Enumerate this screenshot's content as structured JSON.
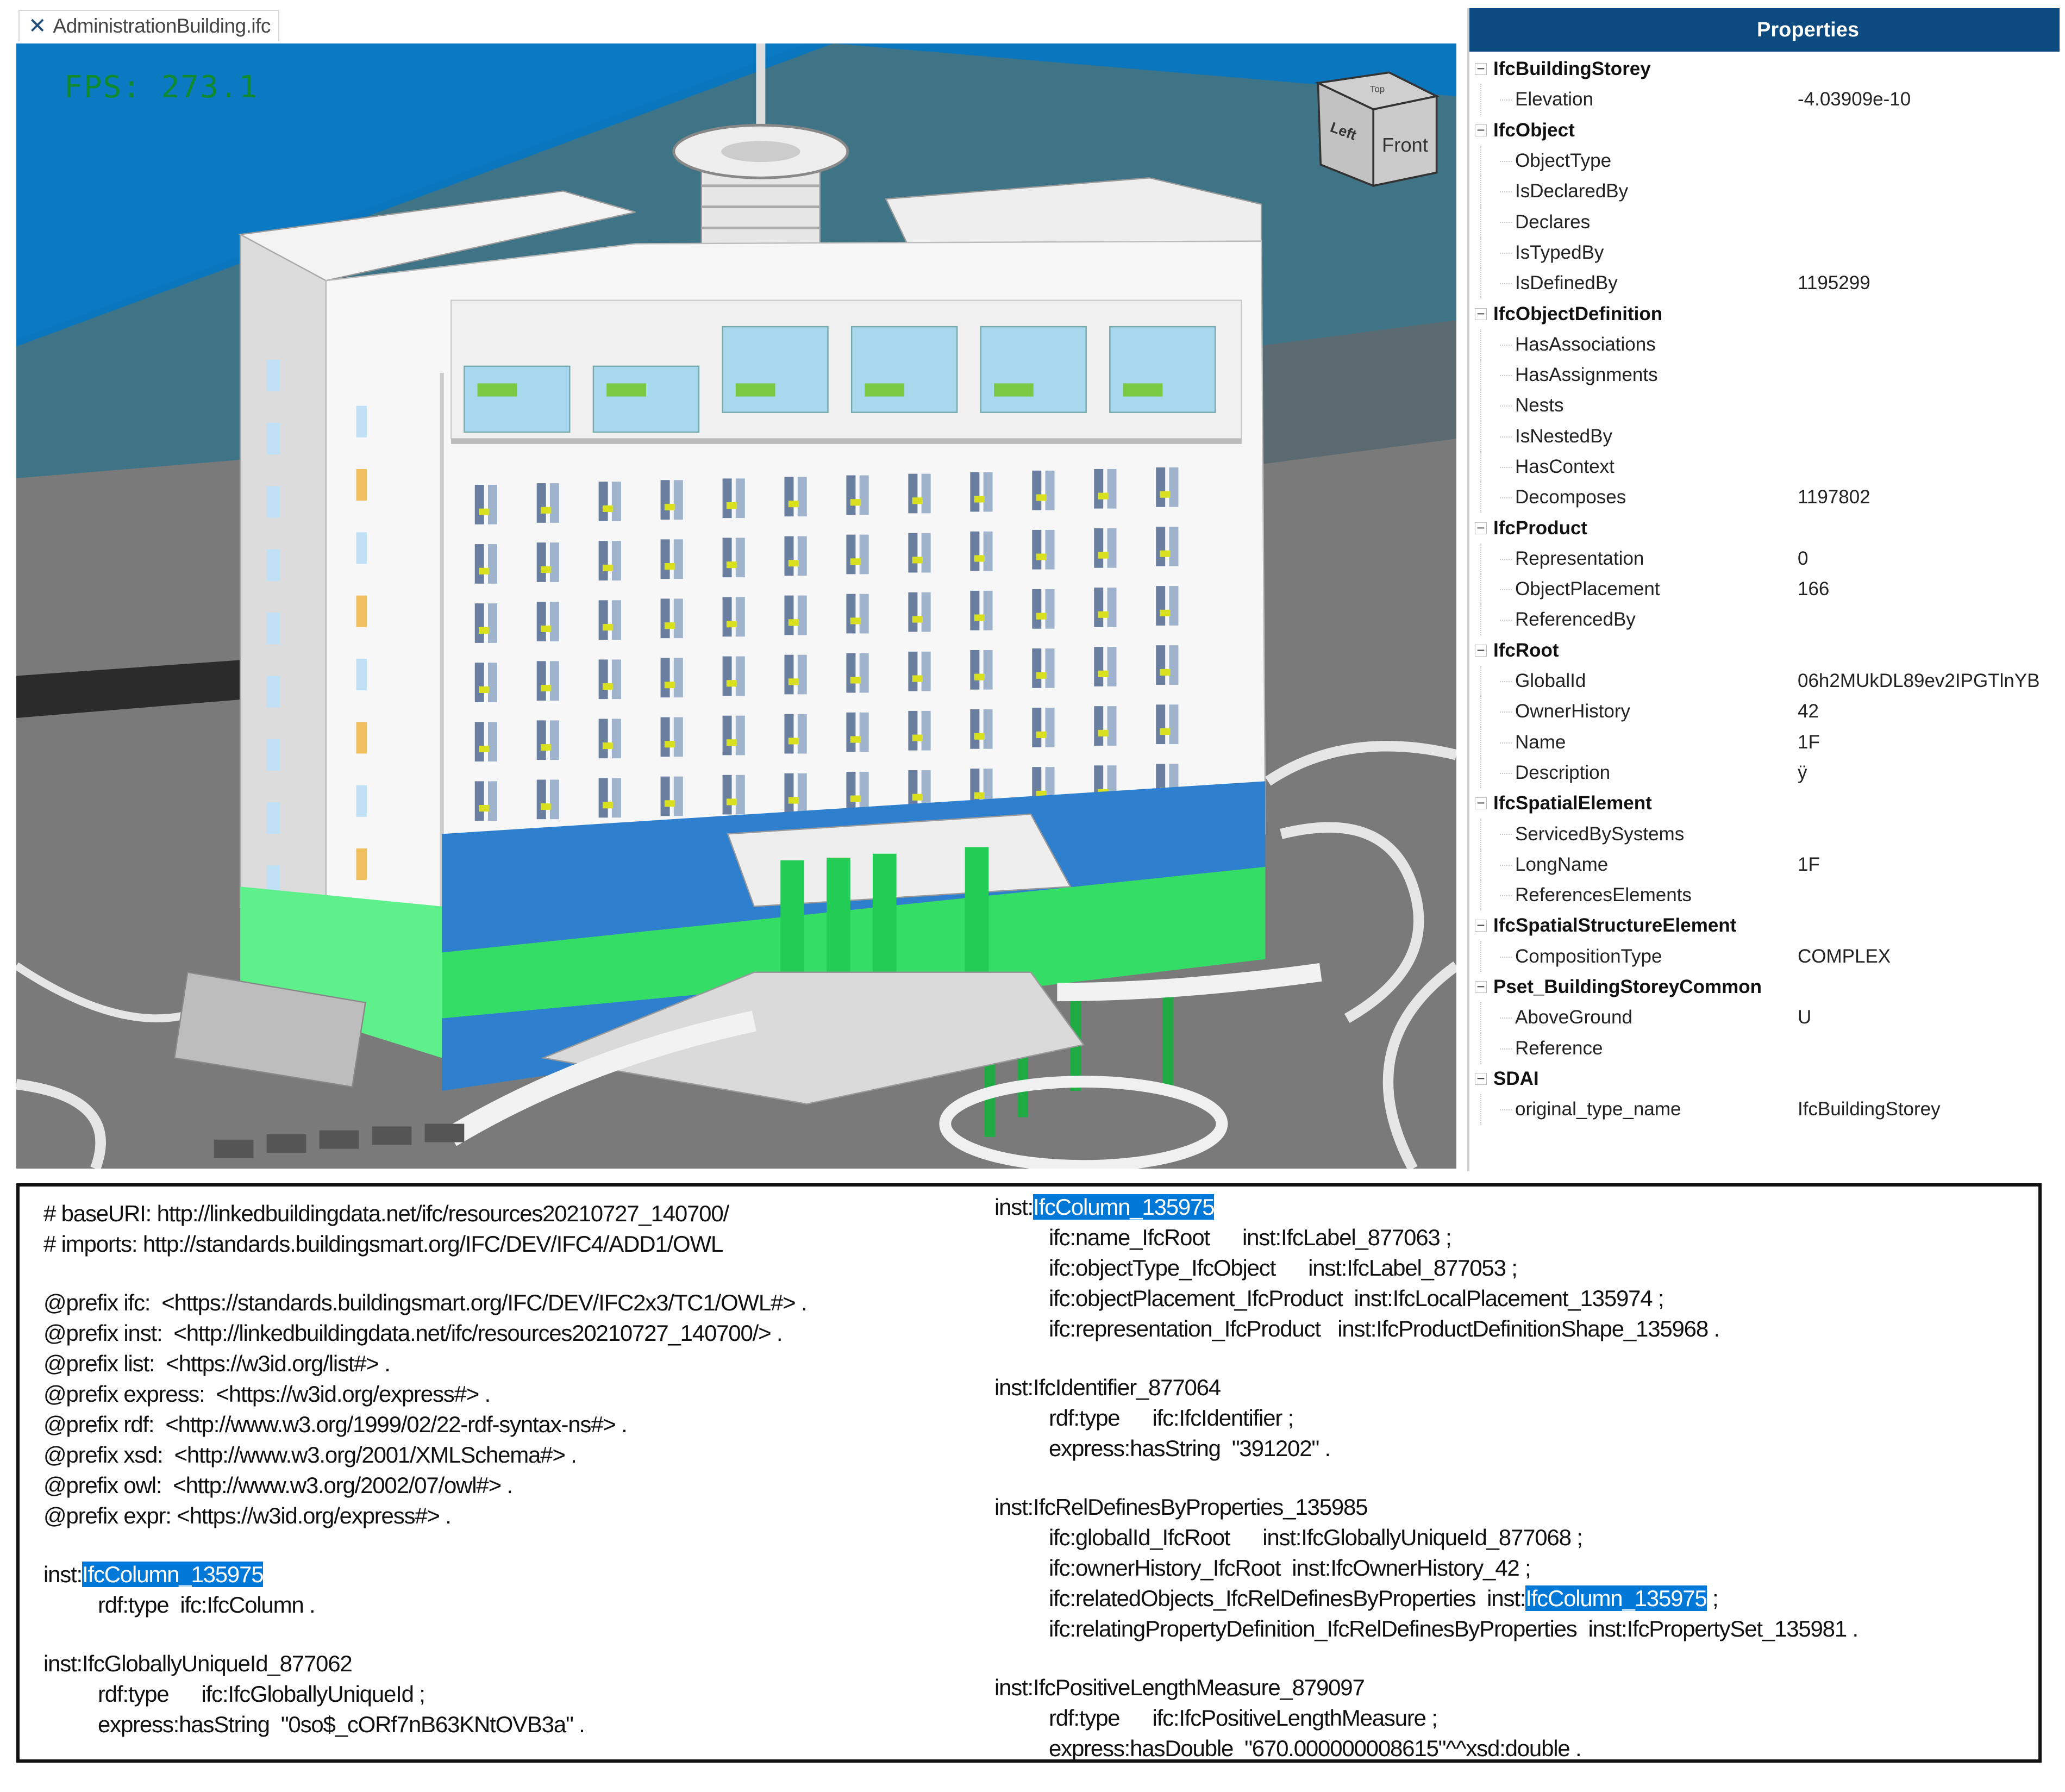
{
  "tab": {
    "title": "AdministrationBuilding.ifc",
    "close_icon": "close-icon"
  },
  "viewport": {
    "fps_label": "FPS:  273.1",
    "view_cube": {
      "front": "Front",
      "left": "Left",
      "top": "Top"
    },
    "colors": {
      "sky": "#0a76bd",
      "ground": "#7a7a7a",
      "selected_green": "#33dd66",
      "blue_band": "#2f7fcf"
    }
  },
  "properties": {
    "title": "Properties",
    "groups": [
      {
        "name": "IfcBuildingStorey",
        "items": [
          {
            "label": "Elevation",
            "value": "-4.03909e-10"
          }
        ]
      },
      {
        "name": "IfcObject",
        "items": [
          {
            "label": "ObjectType",
            "value": ""
          },
          {
            "label": "IsDeclaredBy",
            "value": ""
          },
          {
            "label": "Declares",
            "value": ""
          },
          {
            "label": "IsTypedBy",
            "value": ""
          },
          {
            "label": "IsDefinedBy",
            "value": "1195299"
          }
        ]
      },
      {
        "name": "IfcObjectDefinition",
        "items": [
          {
            "label": "HasAssociations",
            "value": ""
          },
          {
            "label": "HasAssignments",
            "value": ""
          },
          {
            "label": "Nests",
            "value": ""
          },
          {
            "label": "IsNestedBy",
            "value": ""
          },
          {
            "label": "HasContext",
            "value": ""
          },
          {
            "label": "Decomposes",
            "value": "1197802"
          }
        ]
      },
      {
        "name": "IfcProduct",
        "items": [
          {
            "label": "Representation",
            "value": "0"
          },
          {
            "label": "ObjectPlacement",
            "value": "166"
          },
          {
            "label": "ReferencedBy",
            "value": ""
          }
        ]
      },
      {
        "name": "IfcRoot",
        "items": [
          {
            "label": "GlobalId",
            "value": "06h2MUkDL89ev2IPGTlnYB"
          },
          {
            "label": "OwnerHistory",
            "value": "42"
          },
          {
            "label": "Name",
            "value": "1F"
          },
          {
            "label": "Description",
            "value": "ÿ"
          }
        ]
      },
      {
        "name": "IfcSpatialElement",
        "items": [
          {
            "label": "ServicedBySystems",
            "value": ""
          },
          {
            "label": "LongName",
            "value": "1F"
          },
          {
            "label": "ReferencesElements",
            "value": ""
          }
        ]
      },
      {
        "name": "IfcSpatialStructureElement",
        "items": [
          {
            "label": "CompositionType",
            "value": "COMPLEX"
          }
        ]
      },
      {
        "name": "Pset_BuildingStoreyCommon",
        "items": [
          {
            "label": "AboveGround",
            "value": "U"
          },
          {
            "label": "Reference",
            "value": ""
          }
        ]
      },
      {
        "name": "SDAI",
        "items": [
          {
            "label": "original_type_name",
            "value": "IfcBuildingStorey"
          }
        ]
      }
    ]
  },
  "code": {
    "left": [
      [
        {
          "indent": false,
          "segs": [
            {
              "t": "# baseURI: http://linkedbuildingdata.net/ifc/resources20210727_140700/"
            }
          ]
        },
        {
          "indent": false,
          "segs": [
            {
              "t": "# imports: http://standards.buildingsmart.org/IFC/DEV/IFC4/ADD1/OWL"
            }
          ]
        }
      ],
      [
        {
          "indent": false,
          "segs": [
            {
              "t": "@prefix ifc:  <https://standards.buildingsmart.org/IFC/DEV/IFC2x3/TC1/OWL#> ."
            }
          ]
        },
        {
          "indent": false,
          "segs": [
            {
              "t": "@prefix inst:  <http://linkedbuildingdata.net/ifc/resources20210727_140700/> ."
            }
          ]
        },
        {
          "indent": false,
          "segs": [
            {
              "t": "@prefix list:  <https://w3id.org/list#> ."
            }
          ]
        },
        {
          "indent": false,
          "segs": [
            {
              "t": "@prefix express:  <https://w3id.org/express#> ."
            }
          ]
        },
        {
          "indent": false,
          "segs": [
            {
              "t": "@prefix rdf:  <http://www.w3.org/1999/02/22-rdf-syntax-ns#> ."
            }
          ]
        },
        {
          "indent": false,
          "segs": [
            {
              "t": "@prefix xsd:  <http://www.w3.org/2001/XMLSchema#> ."
            }
          ]
        },
        {
          "indent": false,
          "segs": [
            {
              "t": "@prefix owl:  <http://www.w3.org/2002/07/owl#> ."
            }
          ]
        },
        {
          "indent": false,
          "segs": [
            {
              "t": "@prefix expr: <https://w3id.org/express#> ."
            }
          ]
        }
      ],
      [
        {
          "indent": false,
          "segs": [
            {
              "t": "inst:"
            },
            {
              "t": "IfcColumn_135975",
              "hl": true
            }
          ]
        },
        {
          "indent": true,
          "segs": [
            {
              "t": "rdf:type  ifc:IfcColumn ."
            }
          ]
        }
      ],
      [
        {
          "indent": false,
          "segs": [
            {
              "t": "inst:IfcGloballyUniqueId_877062"
            }
          ]
        },
        {
          "indent": true,
          "segs": [
            {
              "t": "rdf:type"
            },
            {
              "gap": true
            },
            {
              "t": "ifc:IfcGloballyUniqueId ;"
            }
          ]
        },
        {
          "indent": true,
          "segs": [
            {
              "t": "express:hasString  \"0so$_cORf7nB63KNtOVB3a\" ."
            }
          ]
        }
      ]
    ],
    "right": [
      [
        {
          "indent": false,
          "segs": [
            {
              "t": "inst:"
            },
            {
              "t": "IfcColumn_135975",
              "hl": true
            }
          ]
        },
        {
          "indent": true,
          "segs": [
            {
              "t": "ifc:name_IfcRoot"
            },
            {
              "gap": true
            },
            {
              "t": "inst:IfcLabel_877063 ;"
            }
          ]
        },
        {
          "indent": true,
          "segs": [
            {
              "t": "ifc:objectType_IfcObject"
            },
            {
              "gap": true
            },
            {
              "t": "inst:IfcLabel_877053 ;"
            }
          ]
        },
        {
          "indent": true,
          "segs": [
            {
              "t": "ifc:objectPlacement_IfcProduct  inst:IfcLocalPlacement_135974 ;"
            }
          ]
        },
        {
          "indent": true,
          "segs": [
            {
              "t": "ifc:representation_IfcProduct   inst:IfcProductDefinitionShape_135968 ."
            }
          ]
        }
      ],
      [
        {
          "indent": false,
          "segs": [
            {
              "t": "inst:IfcIdentifier_877064"
            }
          ]
        },
        {
          "indent": true,
          "segs": [
            {
              "t": "rdf:type"
            },
            {
              "gap": true
            },
            {
              "t": "ifc:IfcIdentifier ;"
            }
          ]
        },
        {
          "indent": true,
          "segs": [
            {
              "t": "express:hasString  \"391202\" ."
            }
          ]
        }
      ],
      [
        {
          "indent": false,
          "segs": [
            {
              "t": "inst:IfcRelDefinesByProperties_135985"
            }
          ]
        },
        {
          "indent": true,
          "segs": [
            {
              "t": "ifc:globalId_IfcRoot"
            },
            {
              "gap": true
            },
            {
              "t": "inst:IfcGloballyUniqueId_877068 ;"
            }
          ]
        },
        {
          "indent": true,
          "segs": [
            {
              "t": "ifc:ownerHistory_IfcRoot  inst:IfcOwnerHistory_42 ;"
            }
          ]
        },
        {
          "indent": true,
          "segs": [
            {
              "t": "ifc:relatedObjects_IfcRelDefinesByProperties  inst:"
            },
            {
              "t": "IfcColumn_135975",
              "hl": true
            },
            {
              "t": " ;"
            }
          ]
        },
        {
          "indent": true,
          "segs": [
            {
              "t": "ifc:relatingPropertyDefinition_IfcRelDefinesByProperties  inst:IfcPropertySet_135981 ."
            }
          ]
        }
      ],
      [
        {
          "indent": false,
          "segs": [
            {
              "t": "inst:IfcPositiveLengthMeasure_879097"
            }
          ]
        },
        {
          "indent": true,
          "segs": [
            {
              "t": "rdf:type"
            },
            {
              "gap": true
            },
            {
              "t": "ifc:IfcPositiveLengthMeasure ;"
            }
          ]
        },
        {
          "indent": true,
          "segs": [
            {
              "t": "express:hasDouble  \"670.000000008615\"^^xsd:double ."
            }
          ]
        }
      ]
    ]
  }
}
